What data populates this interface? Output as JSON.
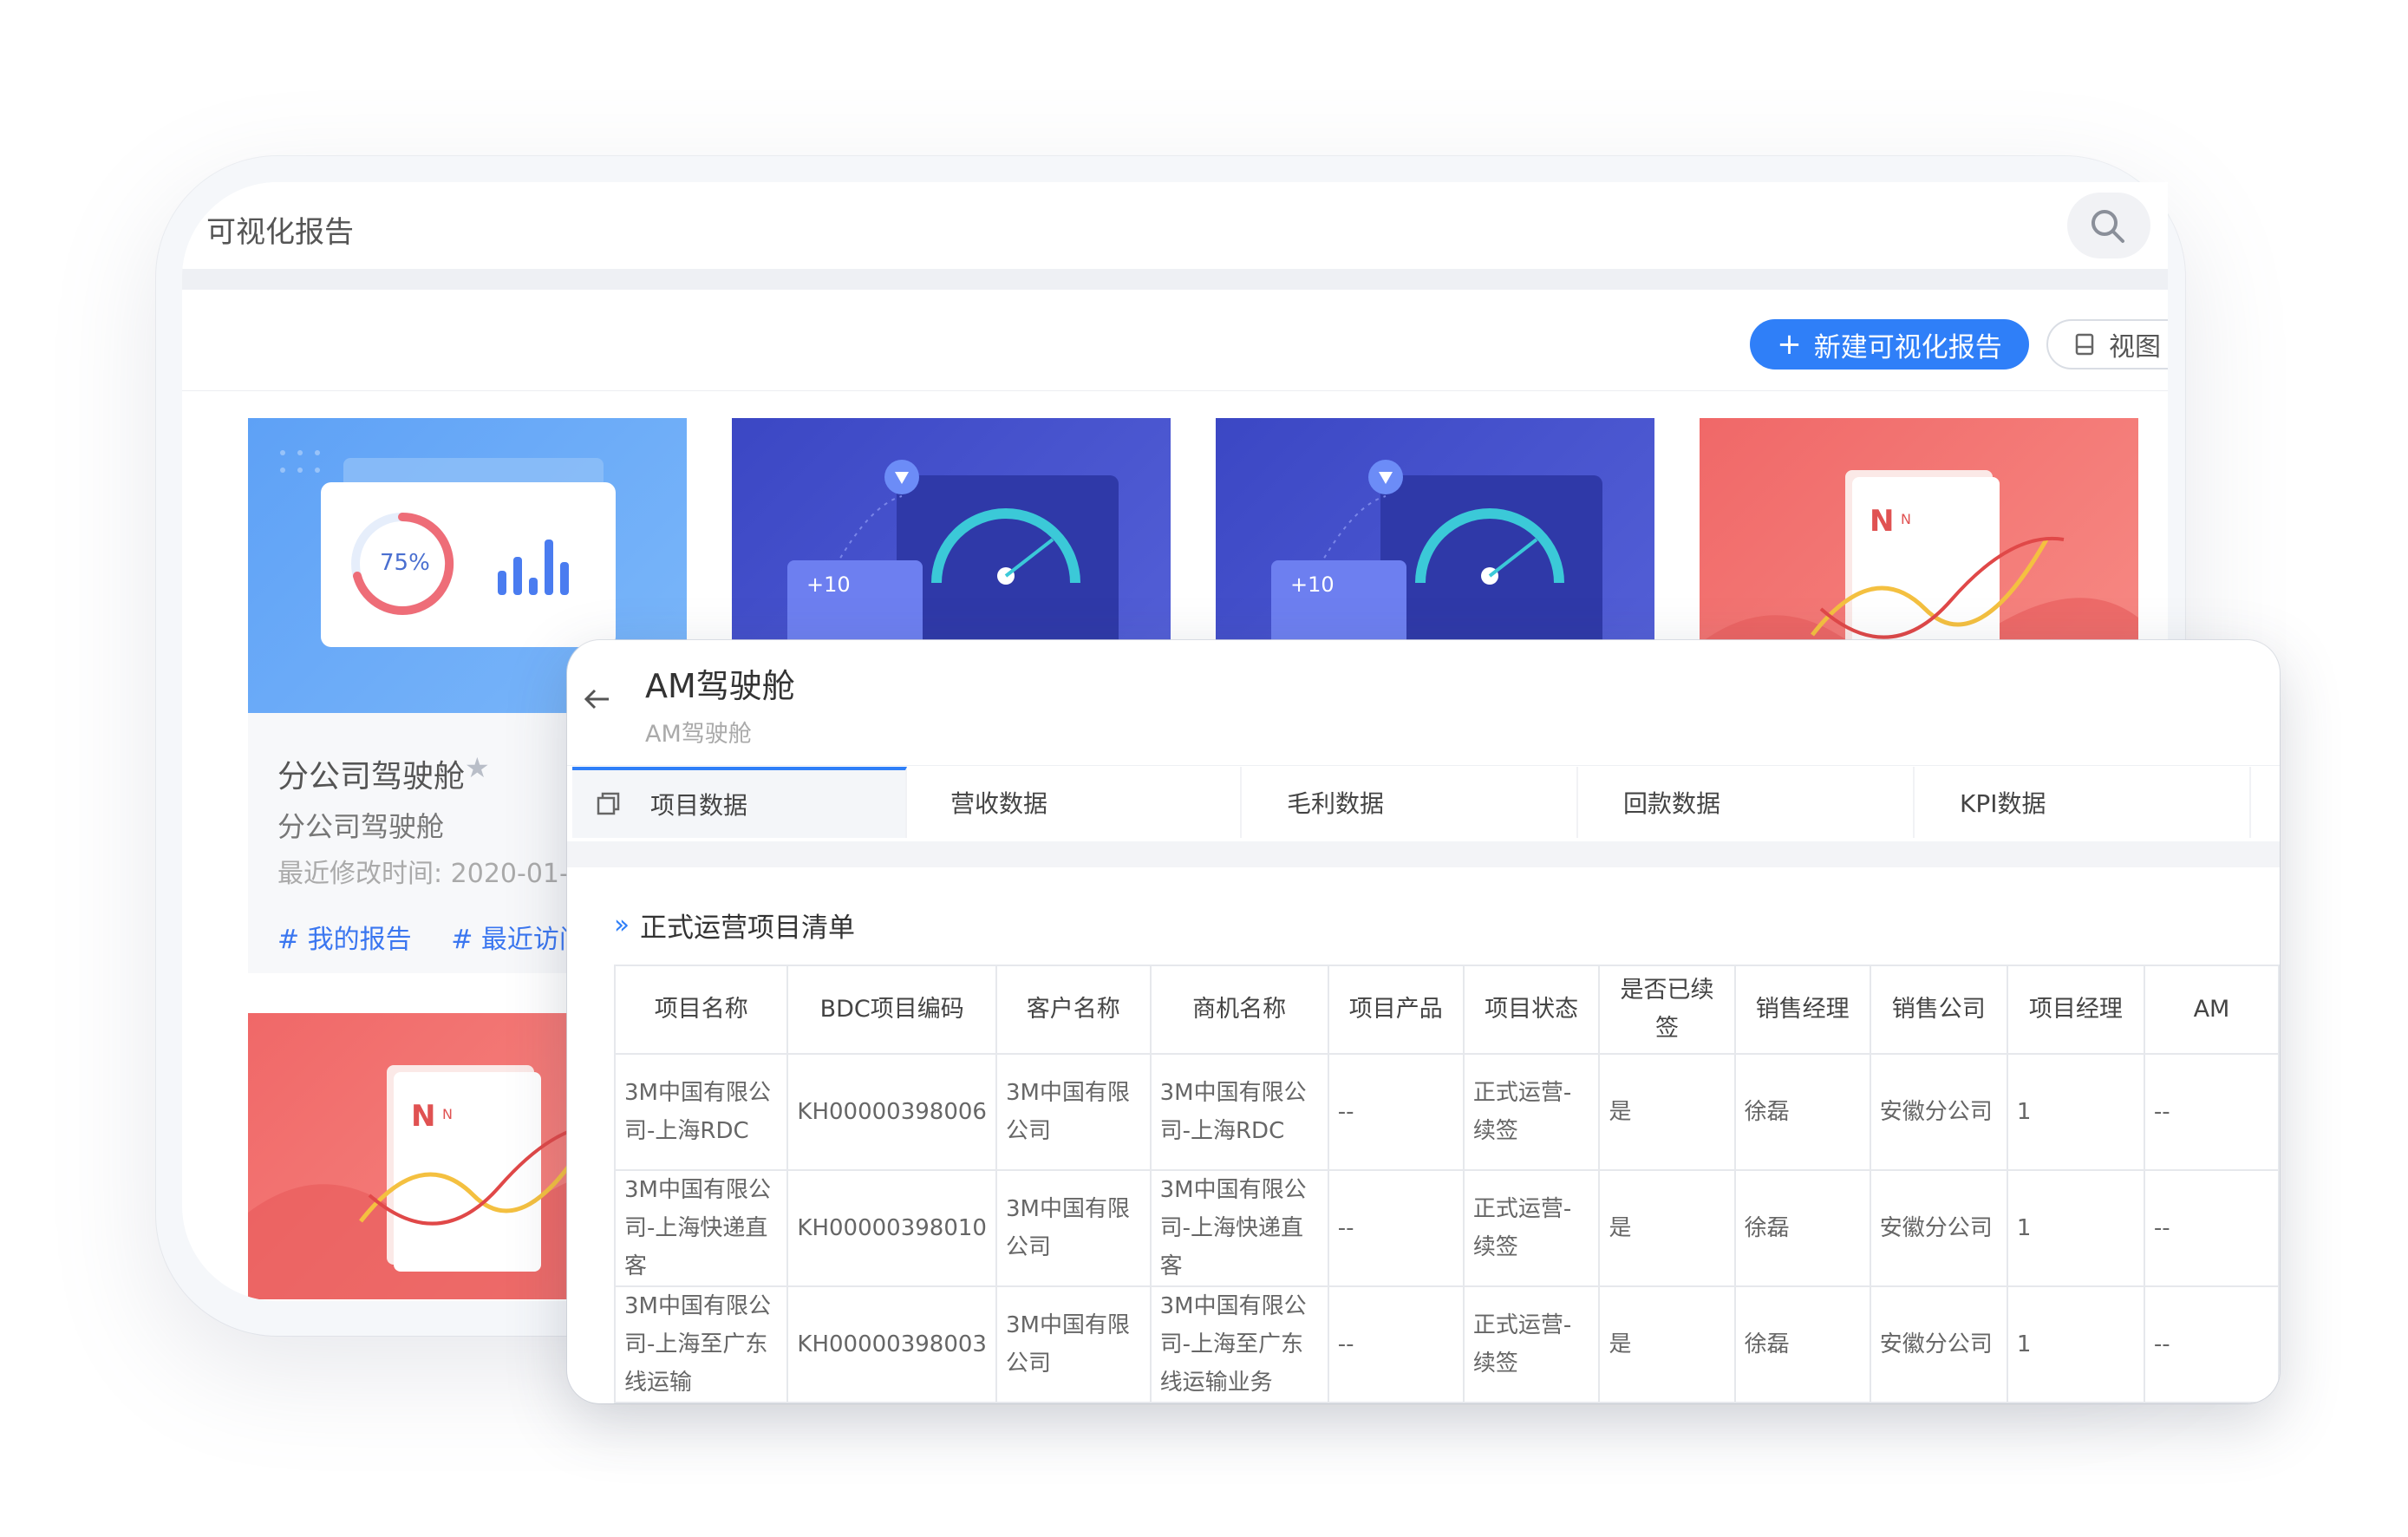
{
  "back_window": {
    "title": "可视化报告",
    "new_button": "新建可视化报告",
    "new_button_icon": "plus-icon",
    "view_button": "视图",
    "card": {
      "name": "分公司驾驶舱",
      "desc": "分公司驾驶舱",
      "time": "最近修改时间: 2020-01-",
      "tags": [
        "# 我的报告",
        "# 最近访问"
      ]
    },
    "thumb_percent": "75%",
    "thumb_badge": "+10"
  },
  "front_window": {
    "title": "AM驾驶舱",
    "subtitle": "AM驾驶舱",
    "tabs": [
      "项目数据",
      "营收数据",
      "毛利数据",
      "回款数据",
      "KPI数据"
    ],
    "section_title": "正式运营项目清单",
    "table": {
      "headers": [
        "项目名称",
        "BDC项目编码",
        "客户名称",
        "商机名称",
        "项目产品",
        "项目状态",
        "是否已续签",
        "销售经理",
        "销售公司",
        "项目经理",
        "AM"
      ],
      "rows": [
        [
          "3M中国有限公司-上海RDC",
          "KH00000398006",
          "3M中国有限公司",
          "3M中国有限公司-上海RDC",
          "--",
          "正式运营-续签",
          "是",
          "徐磊",
          "安徽分公司",
          "1",
          "--"
        ],
        [
          "3M中国有限公司-上海快递直客",
          "KH00000398010",
          "3M中国有限公司",
          "3M中国有限公司-上海快递直客",
          "--",
          "正式运营-续签",
          "是",
          "徐磊",
          "安徽分公司",
          "1",
          "--"
        ],
        [
          "3M中国有限公司-上海至广东线运输",
          "KH00000398003",
          "3M中国有限公司",
          "3M中国有限公司-上海至广东线运输业务",
          "--",
          "正式运营-续签",
          "是",
          "徐磊",
          "安徽分公司",
          "1",
          "--"
        ]
      ]
    }
  }
}
